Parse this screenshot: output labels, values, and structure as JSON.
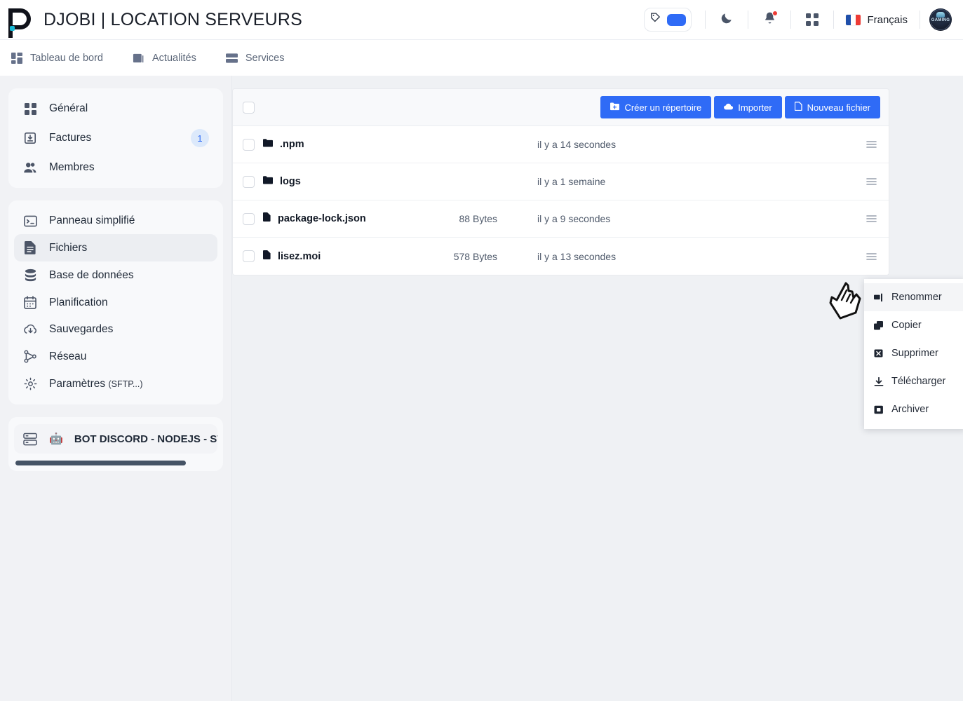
{
  "header": {
    "brand_title": "DJOBI | LOCATION SERVEURS",
    "logo_icon": "djobi-d-logo",
    "theme_icon": "palette-icon",
    "theme_swatch_color": "#2f6bf6",
    "dark_mode_icon": "moon-icon",
    "notifications_icon": "bell-icon",
    "apps_icon": "grid-icon",
    "language_label": "Français",
    "language_flag": "flag-france",
    "avatar_label": "GAMING",
    "avatar_icon": "user-avatar"
  },
  "nav": {
    "items": [
      {
        "label": "Tableau de bord",
        "icon": "dashboard-icon"
      },
      {
        "label": "Actualités",
        "icon": "news-icon"
      },
      {
        "label": "Services",
        "icon": "server-icon"
      }
    ]
  },
  "sidebar": {
    "account": [
      {
        "label": "Général",
        "icon": "grid-icon",
        "badge": ""
      },
      {
        "label": "Factures",
        "icon": "invoice-icon",
        "badge": "1"
      },
      {
        "label": "Membres",
        "icon": "users-icon",
        "badge": ""
      }
    ],
    "server_nav": [
      {
        "label": "Panneau simplifié",
        "icon": "terminal-icon",
        "active": false
      },
      {
        "label": "Fichiers",
        "icon": "file-icon",
        "active": true
      },
      {
        "label": "Base de données",
        "icon": "database-icon",
        "active": false
      },
      {
        "label": "Planification",
        "icon": "calendar-icon",
        "active": false
      },
      {
        "label": "Sauvegardes",
        "icon": "cloud-download-icon",
        "active": false
      },
      {
        "label": "Réseau",
        "icon": "network-icon",
        "active": false
      },
      {
        "label": "Paramètres",
        "suffix": "(SFTP...)",
        "icon": "gear-icon",
        "active": false
      }
    ],
    "server": {
      "icon": "server-rack-icon",
      "emoji": "🤖",
      "name": "BOT DISCORD - NODEJS - ST"
    }
  },
  "files": {
    "select_all_checkbox": "unchecked",
    "actions": [
      {
        "label": "Créer un répertoire",
        "icon": "folder-plus-icon"
      },
      {
        "label": "Importer",
        "icon": "upload-cloud-icon"
      },
      {
        "label": "Nouveau fichier",
        "icon": "file-plus-icon"
      }
    ],
    "rows": [
      {
        "name": ".npm",
        "type": "folder",
        "icon": "folder-icon",
        "size": "",
        "modified": "il y a 14 secondes"
      },
      {
        "name": "logs",
        "type": "folder",
        "icon": "folder-icon",
        "size": "",
        "modified": "il y a 1 semaine"
      },
      {
        "name": "package-lock.json",
        "type": "file",
        "icon": "file-icon",
        "size": "88 Bytes",
        "modified": "il y a 9 secondes"
      },
      {
        "name": "lisez.moi",
        "type": "file",
        "icon": "file-icon",
        "size": "578 Bytes",
        "modified": "il y a 13 secondes"
      }
    ],
    "row_menu_icon": "hamburger-menu-icon"
  },
  "context_menu": {
    "items": [
      {
        "label": "Renommer",
        "icon": "rename-icon",
        "highlighted": true
      },
      {
        "label": "Copier",
        "icon": "copy-icon",
        "highlighted": false
      },
      {
        "label": "Supprimer",
        "icon": "delete-icon",
        "highlighted": false
      },
      {
        "label": "Télécharger",
        "icon": "download-icon",
        "highlighted": false
      },
      {
        "label": "Archiver",
        "icon": "archive-icon",
        "highlighted": false
      }
    ]
  },
  "colors": {
    "accent": "#2f6bf6",
    "page_bg": "#eff1f4",
    "badge_bg": "#dce9fb",
    "notification_dot": "#ee3b35"
  }
}
